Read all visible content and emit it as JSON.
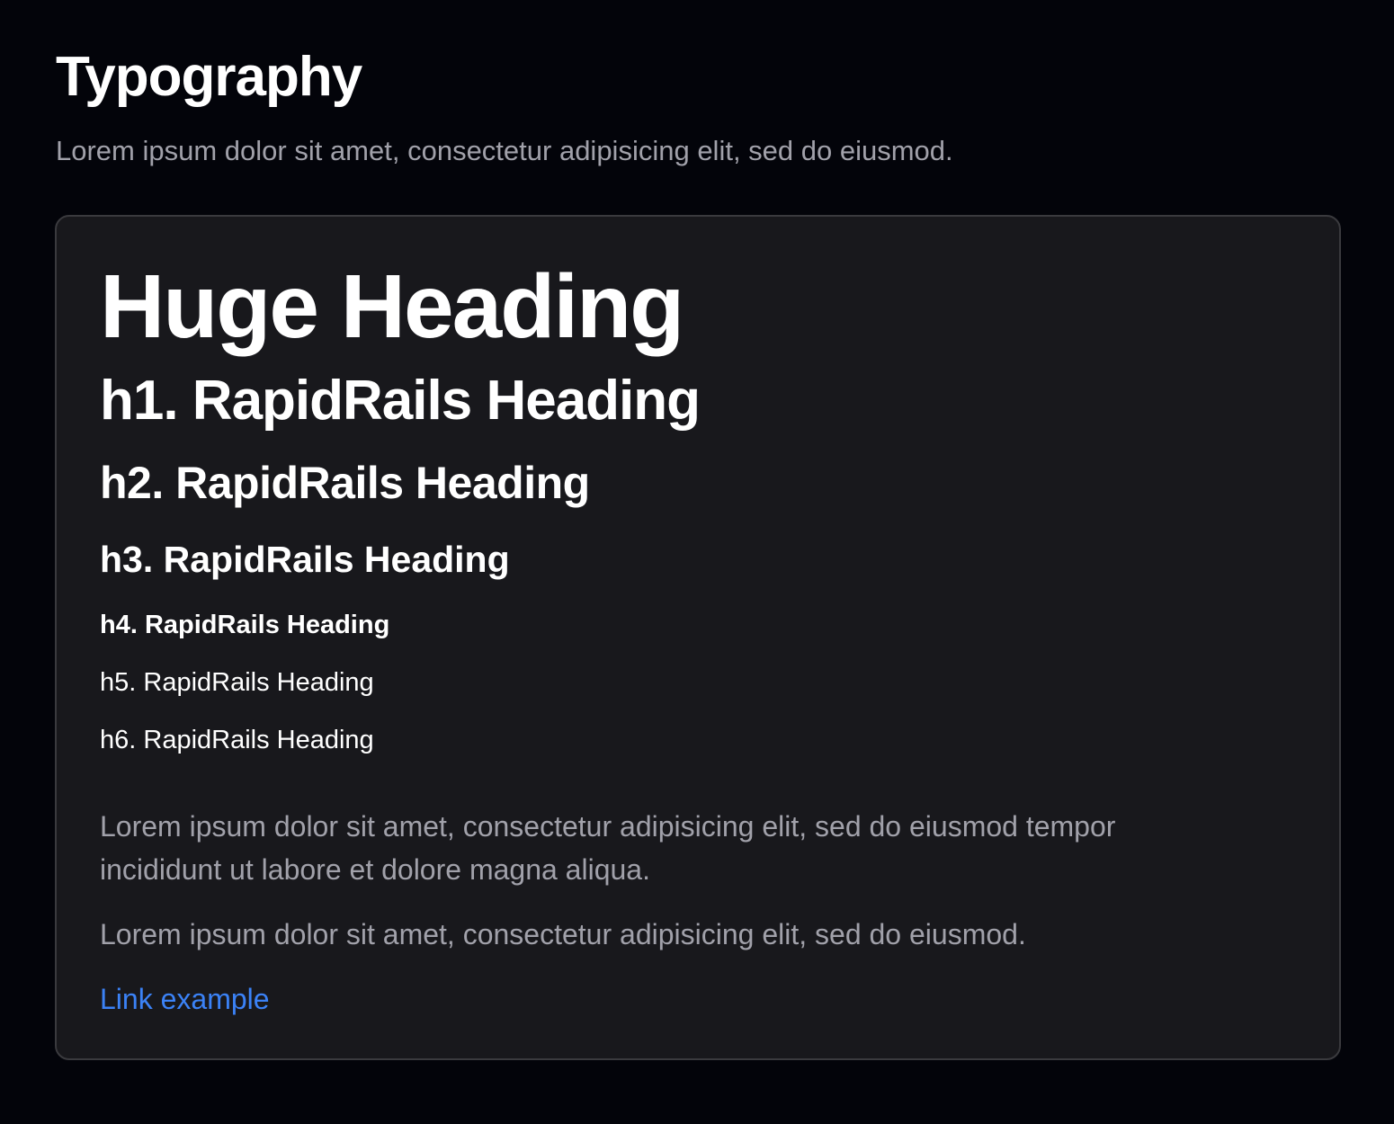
{
  "header": {
    "title": "Typography",
    "subtitle": "Lorem ipsum dolor sit amet, consectetur adipisicing elit, sed do eiusmod."
  },
  "card": {
    "huge_heading": "Huge Heading",
    "h1": "h1. RapidRails Heading",
    "h2": "h2. RapidRails Heading",
    "h3": "h3. RapidRails Heading",
    "h4": "h4. RapidRails Heading",
    "h5": "h5. RapidRails Heading",
    "h6": "h6. RapidRails Heading",
    "paragraph_1": "Lorem ipsum dolor sit amet, consectetur adipisicing elit, sed do eiusmod tempor incididunt ut labore et dolore magna aliqua.",
    "paragraph_2": "Lorem ipsum dolor sit amet, consectetur adipisicing elit, sed do eiusmod.",
    "link_label": "Link example"
  },
  "colors": {
    "background": "#03040a",
    "card": "#18181c",
    "muted_text": "#a1a1aa",
    "link": "#3b82f6"
  }
}
